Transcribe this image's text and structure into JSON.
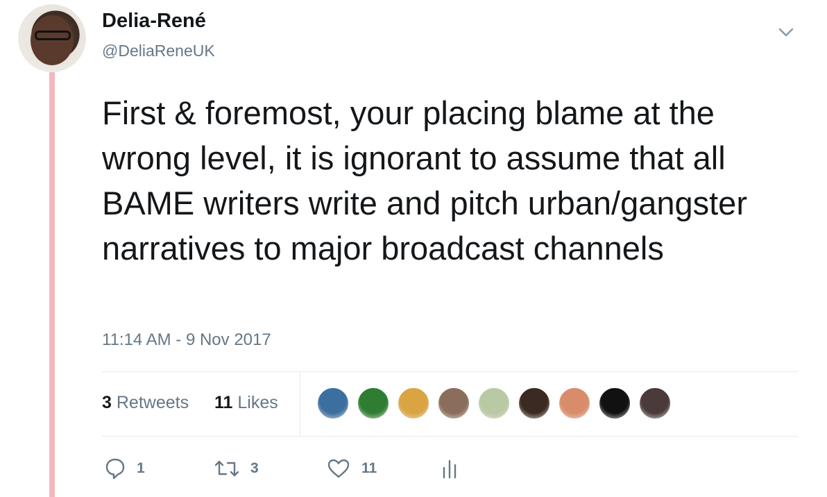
{
  "tweet": {
    "display_name": "Delia-René",
    "handle": "@DeliaReneUK",
    "text": "First & foremost, your placing blame at the wrong level, it is ignorant to assume that all BAME writers write and pitch urban/gangster narratives to major broadcast channels",
    "timestamp": "11:14 AM - 9 Nov 2017"
  },
  "stats": {
    "retweets_count": "3",
    "retweets_label": "Retweets",
    "likes_count": "11",
    "likes_label": "Likes"
  },
  "likers": [
    {
      "name": "liker-avatar-1",
      "color": "#3b6fa0"
    },
    {
      "name": "liker-avatar-2",
      "color": "#2e7d32"
    },
    {
      "name": "liker-avatar-3",
      "color": "#d9a441"
    },
    {
      "name": "liker-avatar-4",
      "color": "#8a6d5a"
    },
    {
      "name": "liker-avatar-5",
      "color": "#b8c9a4"
    },
    {
      "name": "liker-avatar-6",
      "color": "#3b2a22"
    },
    {
      "name": "liker-avatar-7",
      "color": "#d98c6a"
    },
    {
      "name": "liker-avatar-8",
      "color": "#111111"
    },
    {
      "name": "liker-avatar-9",
      "color": "#4a3a3a"
    }
  ],
  "actions": {
    "reply_count": "1",
    "retweet_count": "3",
    "like_count": "11"
  },
  "colors": {
    "thread_line": "#f1b8bf",
    "text": "#14171a",
    "secondary": "#657786",
    "divider": "#e1e8ed"
  }
}
